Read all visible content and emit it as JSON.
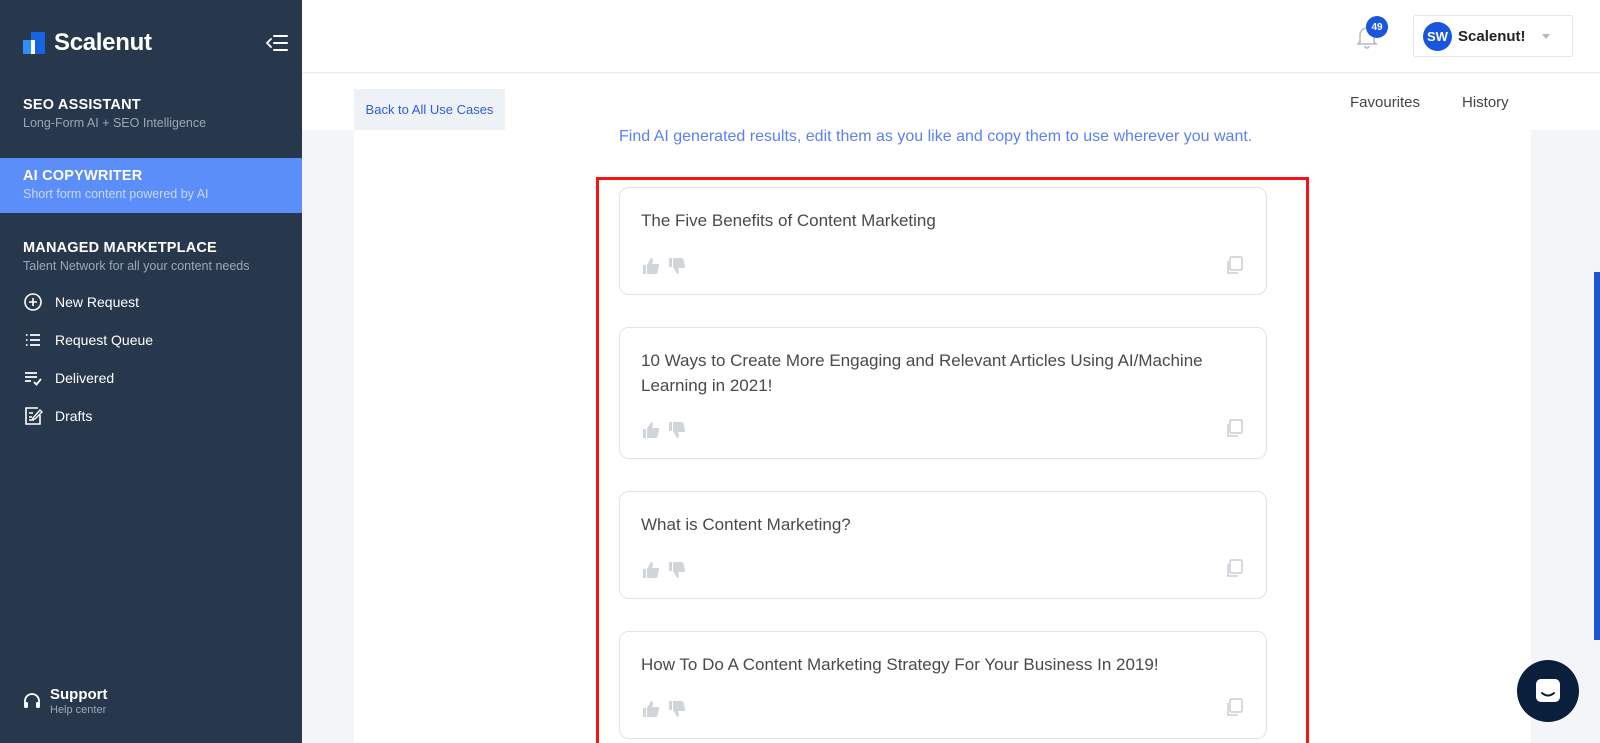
{
  "app": {
    "logo_text": "Scalenut"
  },
  "sidebar": {
    "seo": {
      "title": "SEO ASSISTANT",
      "subtitle": "Long-Form AI + SEO Intelligence"
    },
    "ai": {
      "title": "AI COPYWRITER",
      "subtitle": "Short form content powered by AI"
    },
    "marketplace": {
      "title": "MANAGED MARKETPLACE",
      "subtitle": "Talent Network for all your content needs"
    },
    "items": [
      {
        "label": "New Request",
        "icon": "plus-circle-icon"
      },
      {
        "label": "Request Queue",
        "icon": "list-icon"
      },
      {
        "label": "Delivered",
        "icon": "checklist-icon"
      },
      {
        "label": "Drafts",
        "icon": "edit-icon"
      }
    ],
    "support": {
      "title": "Support",
      "subtitle": "Help center"
    }
  },
  "header": {
    "notification_count": "49",
    "user_initials": "SW",
    "user_name": "Scalenut!"
  },
  "subnav": {
    "back_label": "Back to All Use Cases",
    "favourites_label": "Favourites",
    "history_label": "History"
  },
  "main": {
    "helper_text": "Find AI generated results, edit them as you like and copy them to use wherever you want.",
    "results": [
      {
        "text": "The Five Benefits of Content Marketing"
      },
      {
        "text": "10 Ways to Create More Engaging and Relevant Articles Using AI/Machine Learning in 2021!"
      },
      {
        "text": "What is Content Marketing?"
      },
      {
        "text": "How To Do A Content Marketing Strategy For Your Business In 2019!"
      }
    ]
  },
  "colors": {
    "sidebar_bg": "#28384c",
    "active_item": "#5b8ef8",
    "brand_blue": "#1a56db",
    "highlight_frame": "#f41414"
  }
}
